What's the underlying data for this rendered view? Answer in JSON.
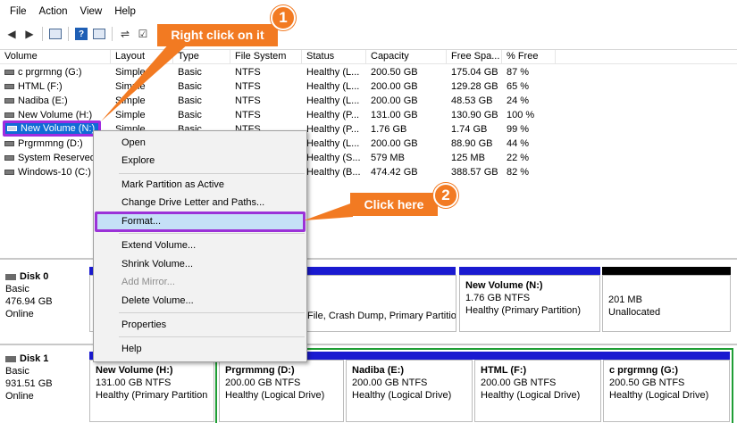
{
  "menu": [
    "File",
    "Action",
    "View",
    "Help"
  ],
  "columns": [
    "Volume",
    "Layout",
    "Type",
    "File System",
    "Status",
    "Capacity",
    "Free Spa...",
    "% Free"
  ],
  "volumes": [
    {
      "name": "c prgrmng (G:)",
      "layout": "Simple",
      "type": "Basic",
      "fs": "NTFS",
      "status": "Healthy (L...",
      "capacity": "200.50 GB",
      "free": "175.04 GB",
      "pct": "87 %"
    },
    {
      "name": "HTML (F:)",
      "layout": "Simple",
      "type": "Basic",
      "fs": "NTFS",
      "status": "Healthy (L...",
      "capacity": "200.00 GB",
      "free": "129.28 GB",
      "pct": "65 %"
    },
    {
      "name": "Nadiba (E:)",
      "layout": "Simple",
      "type": "Basic",
      "fs": "NTFS",
      "status": "Healthy (L...",
      "capacity": "200.00 GB",
      "free": "48.53 GB",
      "pct": "24 %"
    },
    {
      "name": "New Volume (H:)",
      "layout": "Simple",
      "type": "Basic",
      "fs": "NTFS",
      "status": "Healthy (P...",
      "capacity": "131.00 GB",
      "free": "130.90 GB",
      "pct": "100 %"
    },
    {
      "name": "New Volume (N:)",
      "layout": "Simple",
      "type": "Basic",
      "fs": "NTFS",
      "status": "Healthy (P...",
      "capacity": "1.76 GB",
      "free": "1.74 GB",
      "pct": "99 %"
    },
    {
      "name": "Prgrmmng (D:)",
      "layout": "",
      "type": "",
      "fs": "",
      "status": "Healthy (L...",
      "capacity": "200.00 GB",
      "free": "88.90 GB",
      "pct": "44 %"
    },
    {
      "name": "System Reserved",
      "layout": "",
      "type": "",
      "fs": "",
      "status": "Healthy (S...",
      "capacity": "579 MB",
      "free": "125 MB",
      "pct": "22 %"
    },
    {
      "name": "Windows-10 (C:)",
      "layout": "",
      "type": "",
      "fs": "",
      "status": "Healthy (B...",
      "capacity": "474.42 GB",
      "free": "388.57 GB",
      "pct": "82 %"
    }
  ],
  "context_menu": {
    "open": "Open",
    "explore": "Explore",
    "mark_active": "Mark Partition as Active",
    "change_letter": "Change Drive Letter and Paths...",
    "format": "Format...",
    "extend": "Extend Volume...",
    "shrink": "Shrink Volume...",
    "add_mirror": "Add Mirror...",
    "delete": "Delete Volume...",
    "properties": "Properties",
    "help": "Help"
  },
  "callouts": {
    "step1_text": "Right click on it",
    "step1_num": "1",
    "step2_text": "Click here",
    "step2_num": "2"
  },
  "disk0": {
    "name": "Disk 0",
    "type": "Basic",
    "size": "476.94 GB",
    "status": "Online",
    "partial_text": "File, Crash Dump, Primary Partitio",
    "newvol_title": "New Volume  (N:)",
    "newvol_size": "1.76 GB NTFS",
    "newvol_status": "Healthy (Primary Partition)",
    "unalloc_size": "201 MB",
    "unalloc_label": "Unallocated"
  },
  "disk1": {
    "name": "Disk 1",
    "type": "Basic",
    "size": "931.51 GB",
    "status": "Online",
    "parts": [
      {
        "title": "New Volume  (H:)",
        "size": "131.00 GB NTFS",
        "status": "Healthy (Primary Partition"
      },
      {
        "title": "Prgrmmng  (D:)",
        "size": "200.00 GB NTFS",
        "status": "Healthy (Logical Drive)"
      },
      {
        "title": "Nadiba  (E:)",
        "size": "200.00 GB NTFS",
        "status": "Healthy (Logical Drive)"
      },
      {
        "title": "HTML  (F:)",
        "size": "200.00 GB NTFS",
        "status": "Healthy (Logical Drive)"
      },
      {
        "title": "c prgrmng  (G:)",
        "size": "200.50 GB NTFS",
        "status": "Healthy (Logical Drive)"
      }
    ]
  },
  "colors": {
    "accent_orange": "#f27a22",
    "highlight_purple": "#9b32d8",
    "primary_bar": "#1a1ad0",
    "logical_green": "#1f9e35",
    "unalloc_black": "#000000"
  }
}
